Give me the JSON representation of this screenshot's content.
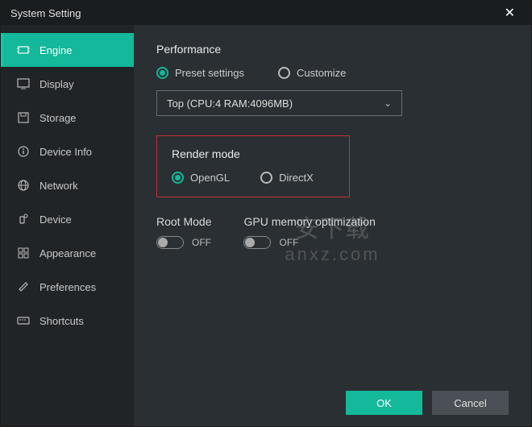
{
  "title": "System Setting",
  "sidebar": {
    "items": [
      {
        "label": "Engine"
      },
      {
        "label": "Display"
      },
      {
        "label": "Storage"
      },
      {
        "label": "Device Info"
      },
      {
        "label": "Network"
      },
      {
        "label": "Device"
      },
      {
        "label": "Appearance"
      },
      {
        "label": "Preferences"
      },
      {
        "label": "Shortcuts"
      }
    ]
  },
  "performance": {
    "title": "Performance",
    "preset_label": "Preset settings",
    "customize_label": "Customize",
    "select_value": "Top (CPU:4 RAM:4096MB)"
  },
  "render": {
    "title": "Render mode",
    "opengl_label": "OpenGL",
    "directx_label": "DirectX"
  },
  "root": {
    "title": "Root Mode",
    "state": "OFF"
  },
  "gpu": {
    "title": "GPU memory optimization",
    "state": "OFF"
  },
  "footer": {
    "ok": "OK",
    "cancel": "Cancel"
  },
  "watermark": {
    "line1": "安下载",
    "line2": "anxz.com"
  }
}
